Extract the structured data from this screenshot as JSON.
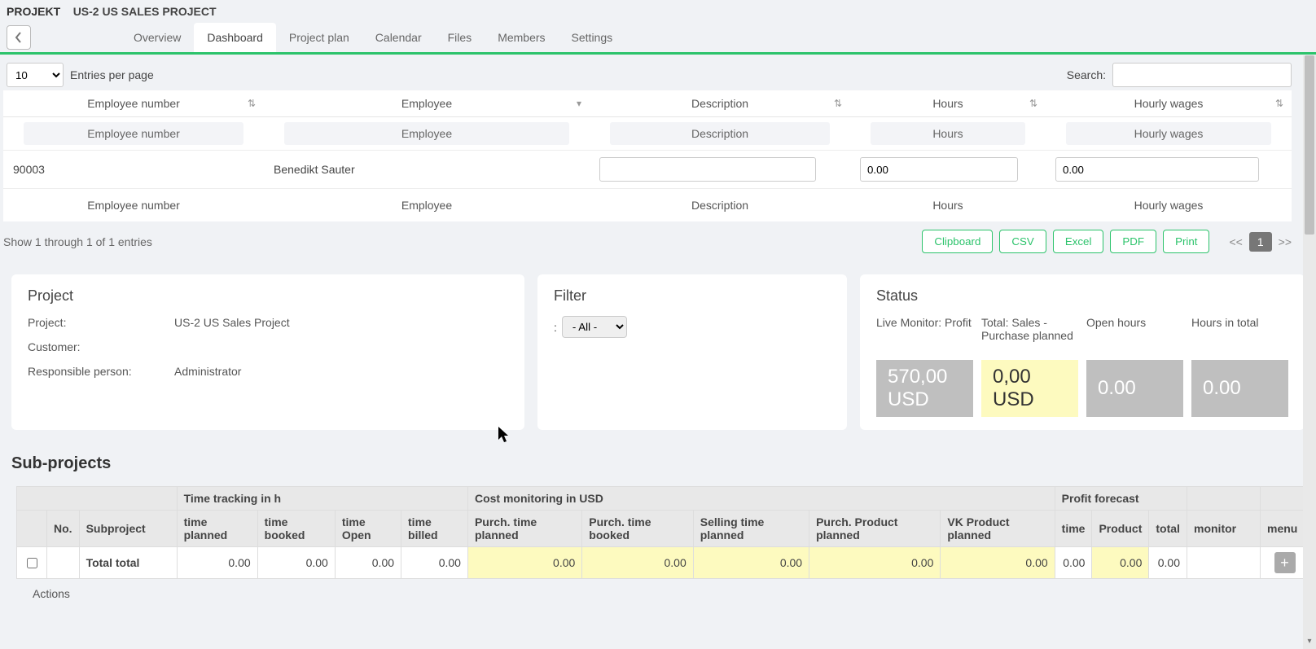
{
  "breadcrumb": {
    "root": "PROJEKT",
    "sub": "US-2 US SALES PROJECT"
  },
  "tabs": [
    "Overview",
    "Dashboard",
    "Project plan",
    "Calendar",
    "Files",
    "Members",
    "Settings"
  ],
  "active_tab": "Dashboard",
  "entries": {
    "value": "10",
    "label": "Entries per page"
  },
  "search": {
    "label": "Search:",
    "value": ""
  },
  "grid": {
    "headers": [
      "Employee number",
      "Employee",
      "Description",
      "Hours",
      "Hourly wages"
    ],
    "filters": [
      "Employee number",
      "Employee",
      "Description",
      "Hours",
      "Hourly wages"
    ],
    "row": {
      "emp_no": "90003",
      "employee": "Benedikt Sauter",
      "description": "",
      "hours": "0.00",
      "wages": "0.00"
    },
    "footers": [
      "Employee number",
      "Employee",
      "Description",
      "Hours",
      "Hourly wages"
    ]
  },
  "tablefooter": {
    "info": "Show 1 through 1 of 1 entries",
    "buttons": [
      "Clipboard",
      "CSV",
      "Excel",
      "PDF",
      "Print"
    ],
    "pager": {
      "prev": "<<",
      "page": "1",
      "next": ">>"
    }
  },
  "project_panel": {
    "title": "Project",
    "rows": {
      "project_k": "Project:",
      "project_v": "US-2 US Sales Project",
      "customer_k": "Customer:",
      "customer_v": "",
      "resp_k": "Responsible person:",
      "resp_v": "Administrator"
    }
  },
  "filter_panel": {
    "title": "Filter",
    "prefix": ":",
    "value": "- All -"
  },
  "status_panel": {
    "title": "Status",
    "cols": [
      {
        "label": "Live Monitor: Profit",
        "value": "570,00 USD",
        "style": "gray"
      },
      {
        "label": "Total: Sales - Purchase planned",
        "value": "0,00 USD",
        "style": "yellow"
      },
      {
        "label": "Open hours",
        "value": "0.00",
        "style": "gray"
      },
      {
        "label": "Hours in total",
        "value": "0.00",
        "style": "gray"
      }
    ]
  },
  "subprojects": {
    "title": "Sub-projects",
    "groups": [
      "",
      "Time tracking in h",
      "Cost monitoring in USD",
      "Profit forecast",
      "",
      ""
    ],
    "headers": [
      "",
      "No.",
      "Subproject",
      "time planned",
      "time booked",
      "time Open",
      "time billed",
      "Purch. time planned",
      "Purch. time booked",
      "Selling time planned",
      "Purch. Product planned",
      "VK Product planned",
      "time",
      "Product",
      "total",
      "monitor",
      "menu"
    ],
    "totalrow": {
      "label": "Total total",
      "vals": [
        "0.00",
        "0.00",
        "0.00",
        "0.00",
        "0.00",
        "0.00",
        "0.00",
        "0.00",
        "0.00",
        "0.00",
        "0.00",
        "0.00"
      ]
    },
    "actions_label": "Actions"
  }
}
